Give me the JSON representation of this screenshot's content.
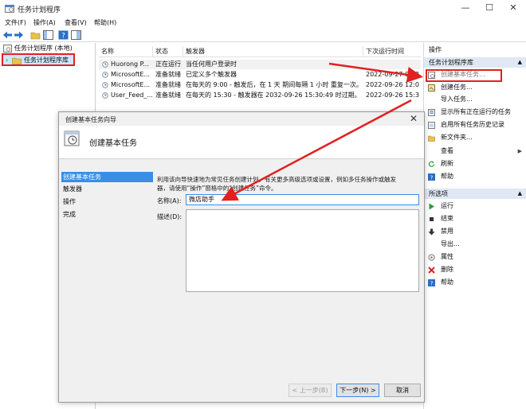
{
  "window": {
    "title": "任务计划程序",
    "minimize": "—",
    "maximize": "☐",
    "close": "✕"
  },
  "menu": [
    "文件(F)",
    "操作(A)",
    "查看(V)",
    "帮助(H)"
  ],
  "tree": {
    "root": "任务计划程序 (本地)",
    "library": "任务计划程序库"
  },
  "task_list": {
    "columns": [
      "名称",
      "状态",
      "触发器",
      "下次运行时间"
    ],
    "rows": [
      {
        "name": "Huorong P...",
        "status": "正在运行",
        "trigger": "当任何用户登录时",
        "next": ""
      },
      {
        "name": "MicrosoftE...",
        "status": "准备就绪",
        "trigger": "已定义多个触发器",
        "next": "2022-09-27 09:3"
      },
      {
        "name": "MicrosoftE...",
        "status": "准备就绪",
        "trigger": "在每天的 9:00 - 触发后，在 1 天 期间每隔 1 小时 重复一次。",
        "next": "2022-09-26 12:0"
      },
      {
        "name": "User_Feed_...",
        "status": "准备就绪",
        "trigger": "在每天的 15:30 - 触发器在 2032-09-26 15:30:49 时过期。",
        "next": "2022-09-26 15:3"
      }
    ]
  },
  "actions": {
    "header": "操作",
    "section1": "任务计划程序库",
    "items1": [
      {
        "label": "创建基本任务...",
        "icon": "create-basic-task-icon"
      },
      {
        "label": "创建任务...",
        "icon": "create-task-icon"
      },
      {
        "label": "导入任务...",
        "icon": ""
      },
      {
        "label": "显示所有正在运行的任务",
        "icon": "running-tasks-icon"
      },
      {
        "label": "启用所有任务历史记录",
        "icon": "history-icon"
      },
      {
        "label": "新文件夹...",
        "icon": "new-folder-icon"
      },
      {
        "label": "查看",
        "icon": "",
        "arrow": "▶"
      },
      {
        "label": "刷新",
        "icon": "refresh-icon"
      },
      {
        "label": "帮助",
        "icon": "help-icon"
      }
    ],
    "section2": "所选项",
    "items2": [
      {
        "label": "运行",
        "icon": "run-icon"
      },
      {
        "label": "结束",
        "icon": "stop-icon"
      },
      {
        "label": "禁用",
        "icon": "disable-icon"
      },
      {
        "label": "导出...",
        "icon": ""
      },
      {
        "label": "属性",
        "icon": "properties-icon"
      },
      {
        "label": "删除",
        "icon": "delete-icon"
      },
      {
        "label": "帮助",
        "icon": "help-icon"
      }
    ]
  },
  "dialog": {
    "title": "创建基本任务向导",
    "heading": "创建基本任务",
    "steps": [
      "创建基本任务",
      "触发器",
      "操作",
      "完成"
    ],
    "intro_line1": "利用该向导快速地为常见任务创建计划。有关更多高级选项或设置，例如多任务操作或触发",
    "intro_line2": "器，请使用“操作”窗格中的“创建任务”命令。",
    "name_label": "名称(A):",
    "name_value": "微店助手",
    "desc_label": "描述(D):",
    "desc_value": "",
    "back_button": "< 上一步(B)",
    "next_button": "下一步(N) >",
    "cancel_button": "取消"
  },
  "colors": {
    "highlight_red": "#e32020",
    "selection_blue": "#cce8ff",
    "section_header": "#dfe8f4"
  }
}
